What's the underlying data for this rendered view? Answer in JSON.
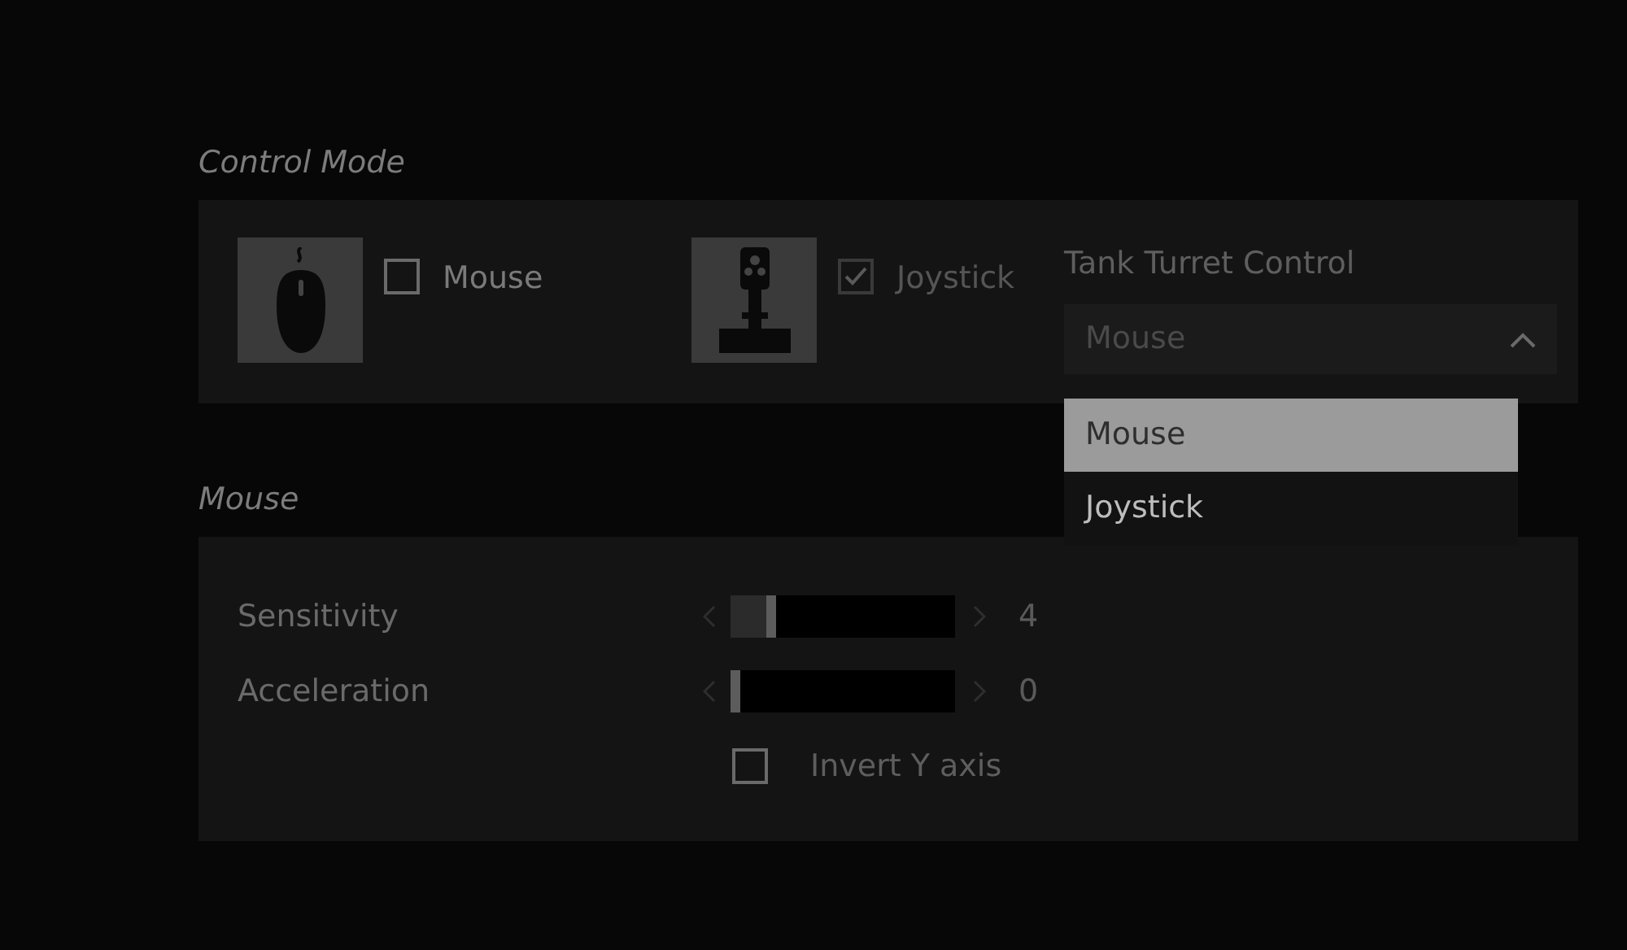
{
  "control_mode": {
    "title": "Control Mode",
    "devices": [
      {
        "kind": "mouse",
        "label": "Mouse",
        "checked": false,
        "disabled": false
      },
      {
        "kind": "joystick",
        "label": "Joystick",
        "checked": true,
        "disabled": true
      }
    ],
    "turret": {
      "label": "Tank Turret Control",
      "value": "Mouse",
      "expanded": true,
      "options": [
        {
          "label": "Mouse",
          "selected": true
        },
        {
          "label": "Joystick",
          "selected": false
        }
      ]
    }
  },
  "mouse": {
    "title": "Mouse",
    "sliders": [
      {
        "label": "Sensitivity",
        "level": 0.17,
        "reading": "4"
      },
      {
        "label": "Acceleration",
        "level": 0,
        "reading": "0"
      }
    ],
    "invert": {
      "label": "Invert Y axis",
      "checked": false
    }
  }
}
